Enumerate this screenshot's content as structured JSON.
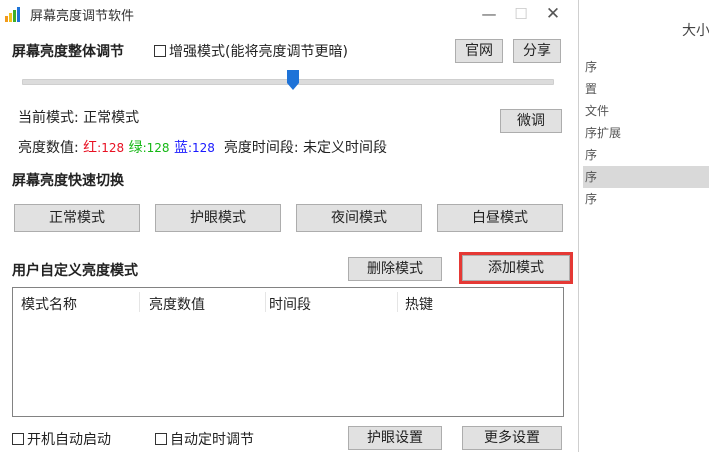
{
  "app": {
    "title": "屏幕亮度调节软件",
    "window_controls": {
      "minimize": "—",
      "maximize": "☐",
      "close": "✕"
    }
  },
  "overall": {
    "section_title": "屏幕亮度整体调节",
    "enhance_checkbox": {
      "label": "增强模式(能将亮度调节更暗)",
      "checked": false
    },
    "official_button": "官网",
    "share_button": "分享",
    "slider_value_fraction": 0.5,
    "current_mode_label": "当前模式:",
    "current_mode_value": "正常模式",
    "fine_tune_button": "微调",
    "brightness_label": "亮度数值:",
    "red_label": "红",
    "red_value": ":128",
    "green_label": "绿",
    "green_value": ":128",
    "blue_label": "蓝",
    "blue_value": ":128",
    "time_label": "亮度时间段:",
    "time_value": "未定义时间段"
  },
  "quick": {
    "section_title": "屏幕亮度快速切换",
    "modes": [
      "正常模式",
      "护眼模式",
      "夜间模式",
      "白昼模式"
    ]
  },
  "custom": {
    "section_title": "用户自定义亮度模式",
    "delete_button": "删除模式",
    "add_button": "添加模式",
    "columns": [
      "模式名称",
      "亮度数值",
      "时间段",
      "热键"
    ],
    "rows": []
  },
  "footer": {
    "autostart_checkbox": {
      "label": "开机自动启动",
      "checked": false
    },
    "timer_checkbox": {
      "label": "自动定时调节",
      "checked": false
    },
    "eye_settings_button": "护眼设置",
    "more_settings_button": "更多设置"
  },
  "background_window": {
    "top_text": "大小",
    "items": [
      "序",
      "置",
      "文件",
      "序扩展",
      "序",
      "序",
      "序"
    ],
    "selected_index": 5
  },
  "colors": {
    "accent_blue": "#1e73d8",
    "highlight_red": "#e53935",
    "red_text": "#e81123",
    "green_text": "#16b816",
    "blue_text": "#1a1aff"
  }
}
